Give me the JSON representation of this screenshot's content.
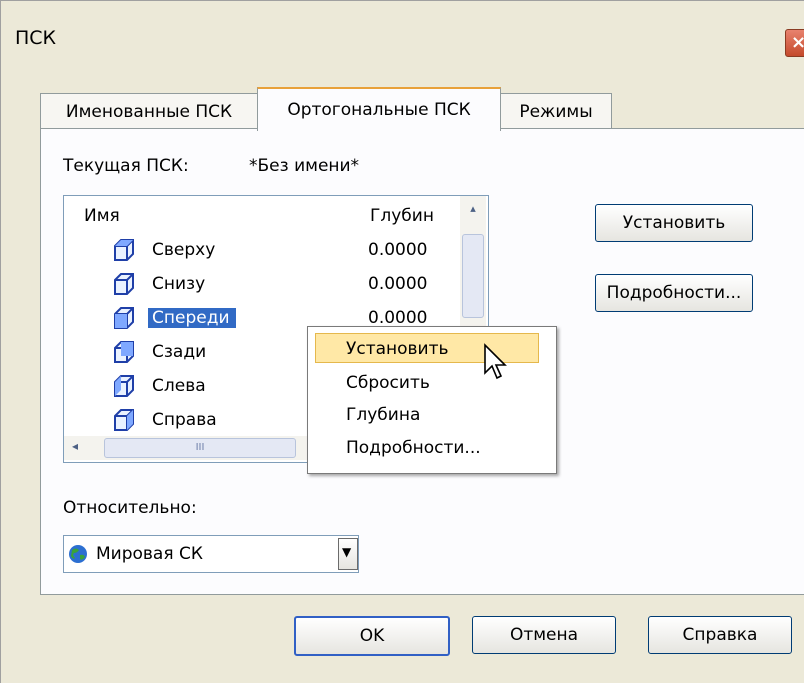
{
  "window": {
    "title": "ПСК",
    "close_glyph": "×"
  },
  "tabs": [
    {
      "label": "Именованные ПСК",
      "active": false
    },
    {
      "label": "Ортогональные ПСК",
      "active": true
    },
    {
      "label": "Режимы",
      "active": false
    }
  ],
  "current": {
    "label": "Текущая ПСК:",
    "value": "*Без имени*"
  },
  "list": {
    "columns": [
      "Имя",
      "Глубин"
    ],
    "rows": [
      {
        "name": "Сверху",
        "depth": "0.0000"
      },
      {
        "name": "Снизу",
        "depth": "0.0000"
      },
      {
        "name": "Спереди",
        "depth": "0.0000",
        "selected": true
      },
      {
        "name": "Сзади",
        "depth": ""
      },
      {
        "name": "Слева",
        "depth": ""
      },
      {
        "name": "Справа",
        "depth": ""
      }
    ],
    "hscroll_grip": "III",
    "scroll_left": "◂",
    "scroll_up": "▴"
  },
  "buttons": {
    "set": "Установить",
    "details": "Подробности...",
    "ok": "OK",
    "cancel": "Отмена",
    "help": "Справка"
  },
  "context_menu": {
    "items": [
      "Установить",
      "Сбросить",
      "Глубина",
      "Подробности..."
    ],
    "highlighted_index": 0
  },
  "relative": {
    "label": "Относительно:",
    "value": "Мировая СК",
    "arrow": "▼"
  },
  "colors": {
    "selection": "#316ac5",
    "menu_highlight": "#ffe8a6",
    "dialog_bg": "#ece9d8"
  }
}
